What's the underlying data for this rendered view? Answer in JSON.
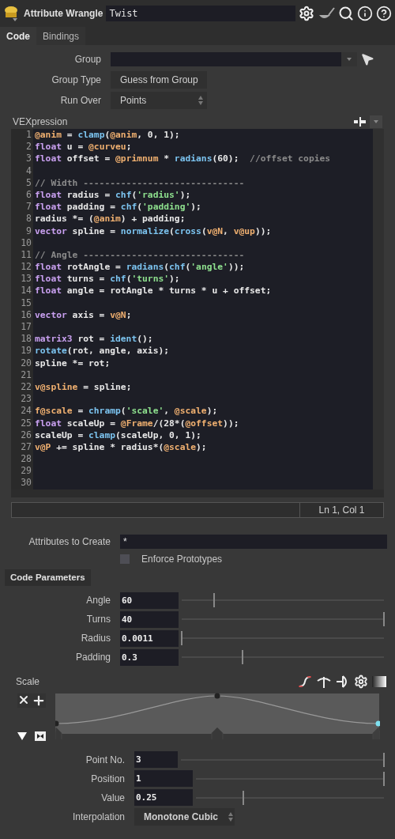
{
  "header": {
    "node_type": "Attribute Wrangle",
    "node_name": "Twist"
  },
  "tabs": [
    {
      "label": "Code",
      "selected": true
    },
    {
      "label": "Bindings",
      "selected": false
    }
  ],
  "fields": [
    {
      "kind": "text",
      "label": "Group"
    },
    {
      "kind": "menu",
      "label": "Group Type",
      "value": "Guess from Group"
    },
    {
      "kind": "menu",
      "label": "Run Over",
      "value": "Points"
    }
  ],
  "editor": {
    "label": "VEXpression",
    "lines": [
      {
        "n": "1",
        "tokens": [
          {
            "kind": "attr",
            "text": "@anim"
          },
          {
            "kind": "plain",
            "text": " = "
          },
          {
            "kind": "fn",
            "text": "clamp"
          },
          {
            "kind": "plain",
            "text": "("
          },
          {
            "kind": "attr",
            "text": "@anim"
          },
          {
            "kind": "plain",
            "text": ", 0, 1);"
          }
        ]
      },
      {
        "n": "2",
        "tokens": [
          {
            "kind": "kw",
            "text": "float"
          },
          {
            "kind": "plain",
            "text": " u = "
          },
          {
            "kind": "attr",
            "text": "@curveu"
          },
          {
            "kind": "plain",
            "text": ";"
          }
        ]
      },
      {
        "n": "3",
        "tokens": [
          {
            "kind": "kw",
            "text": "float"
          },
          {
            "kind": "plain",
            "text": " offset = "
          },
          {
            "kind": "attr",
            "text": "@primnum"
          },
          {
            "kind": "plain",
            "text": " * "
          },
          {
            "kind": "fn",
            "text": "radians"
          },
          {
            "kind": "plain",
            "text": "(60);  "
          },
          {
            "kind": "cm",
            "text": "//offset copies"
          }
        ]
      },
      {
        "n": "4"
      },
      {
        "n": "5",
        "tokens": [
          {
            "kind": "cm",
            "text": "// Width ------------------------------"
          }
        ]
      },
      {
        "n": "6",
        "tokens": [
          {
            "kind": "kw",
            "text": "float"
          },
          {
            "kind": "plain",
            "text": " radius = "
          },
          {
            "kind": "fn",
            "text": "chf"
          },
          {
            "kind": "plain",
            "text": "("
          },
          {
            "kind": "str",
            "text": "'radius'"
          },
          {
            "kind": "plain",
            "text": ");"
          }
        ]
      },
      {
        "n": "7",
        "tokens": [
          {
            "kind": "kw",
            "text": "float"
          },
          {
            "kind": "plain",
            "text": " padding = "
          },
          {
            "kind": "fn",
            "text": "chf"
          },
          {
            "kind": "plain",
            "text": "("
          },
          {
            "kind": "str",
            "text": "'padding'"
          },
          {
            "kind": "plain",
            "text": ");"
          }
        ]
      },
      {
        "n": "8",
        "tokens": [
          {
            "kind": "plain",
            "text": "radius *= ("
          },
          {
            "kind": "attr",
            "text": "@anim"
          },
          {
            "kind": "plain",
            "text": ") + padding;"
          }
        ]
      },
      {
        "n": "9",
        "tokens": [
          {
            "kind": "kw",
            "text": "vector"
          },
          {
            "kind": "plain",
            "text": " spline = "
          },
          {
            "kind": "fn",
            "text": "normalize"
          },
          {
            "kind": "plain",
            "text": "("
          },
          {
            "kind": "fn",
            "text": "cross"
          },
          {
            "kind": "plain",
            "text": "("
          },
          {
            "kind": "attr",
            "text": "v@N"
          },
          {
            "kind": "plain",
            "text": ", "
          },
          {
            "kind": "attr",
            "text": "v@up"
          },
          {
            "kind": "plain",
            "text": "));"
          }
        ]
      },
      {
        "n": "10"
      },
      {
        "n": "11",
        "tokens": [
          {
            "kind": "cm",
            "text": "// Angle ------------------------------"
          }
        ]
      },
      {
        "n": "12",
        "tokens": [
          {
            "kind": "kw",
            "text": "float"
          },
          {
            "kind": "plain",
            "text": " rotAngle = "
          },
          {
            "kind": "fn",
            "text": "radians"
          },
          {
            "kind": "plain",
            "text": "("
          },
          {
            "kind": "fn",
            "text": "chf"
          },
          {
            "kind": "plain",
            "text": "("
          },
          {
            "kind": "str",
            "text": "'angle'"
          },
          {
            "kind": "plain",
            "text": "));"
          }
        ]
      },
      {
        "n": "13",
        "tokens": [
          {
            "kind": "kw",
            "text": "float"
          },
          {
            "kind": "plain",
            "text": " turns = "
          },
          {
            "kind": "fn",
            "text": "chf"
          },
          {
            "kind": "plain",
            "text": "("
          },
          {
            "kind": "str",
            "text": "'turns'"
          },
          {
            "kind": "plain",
            "text": ");"
          }
        ]
      },
      {
        "n": "14",
        "tokens": [
          {
            "kind": "kw",
            "text": "float"
          },
          {
            "kind": "plain",
            "text": " angle = rotAngle * turns * u + offset;"
          }
        ]
      },
      {
        "n": "15"
      },
      {
        "n": "16",
        "tokens": [
          {
            "kind": "kw",
            "text": "vector"
          },
          {
            "kind": "plain",
            "text": " axis = "
          },
          {
            "kind": "attr",
            "text": "v@N"
          },
          {
            "kind": "plain",
            "text": ";"
          }
        ]
      },
      {
        "n": "17"
      },
      {
        "n": "18",
        "tokens": [
          {
            "kind": "kw",
            "text": "matrix3"
          },
          {
            "kind": "plain",
            "text": " rot = "
          },
          {
            "kind": "fn",
            "text": "ident"
          },
          {
            "kind": "plain",
            "text": "();"
          }
        ]
      },
      {
        "n": "19",
        "tokens": [
          {
            "kind": "fn",
            "text": "rotate"
          },
          {
            "kind": "plain",
            "text": "(rot, angle, axis);"
          }
        ]
      },
      {
        "n": "20",
        "tokens": [
          {
            "kind": "plain",
            "text": "spline *= rot;"
          }
        ]
      },
      {
        "n": "21"
      },
      {
        "n": "22",
        "tokens": [
          {
            "kind": "attr",
            "text": "v@spline"
          },
          {
            "kind": "plain",
            "text": " = spline;"
          }
        ]
      },
      {
        "n": "23"
      },
      {
        "n": "24",
        "tokens": [
          {
            "kind": "attr",
            "text": "f@scale"
          },
          {
            "kind": "plain",
            "text": " = "
          },
          {
            "kind": "fn",
            "text": "chramp"
          },
          {
            "kind": "plain",
            "text": "("
          },
          {
            "kind": "str",
            "text": "'scale'"
          },
          {
            "kind": "plain",
            "text": ", "
          },
          {
            "kind": "attr",
            "text": "@scale"
          },
          {
            "kind": "plain",
            "text": ");"
          }
        ]
      },
      {
        "n": "25",
        "tokens": [
          {
            "kind": "kw",
            "text": "float"
          },
          {
            "kind": "plain",
            "text": " scaleUp = "
          },
          {
            "kind": "attr",
            "text": "@Frame"
          },
          {
            "kind": "plain",
            "text": "/(28*("
          },
          {
            "kind": "attr",
            "text": "@offset"
          },
          {
            "kind": "plain",
            "text": "));"
          }
        ]
      },
      {
        "n": "26",
        "tokens": [
          {
            "kind": "plain",
            "text": "scaleUp = "
          },
          {
            "kind": "fn",
            "text": "clamp"
          },
          {
            "kind": "plain",
            "text": "(scaleUp, 0, 1);"
          }
        ]
      },
      {
        "n": "27",
        "tokens": [
          {
            "kind": "attr",
            "text": "v@P"
          },
          {
            "kind": "plain",
            "text": " += spline * radius*("
          },
          {
            "kind": "attr",
            "text": "@scale"
          },
          {
            "kind": "plain",
            "text": ");"
          }
        ]
      },
      {
        "n": "28"
      },
      {
        "n": "29"
      },
      {
        "n": "30"
      }
    ],
    "cursor": "Ln 1, Col 1"
  },
  "attributes_to_create": {
    "label": "Attributes to Create",
    "value": "*"
  },
  "enforce_prototypes": {
    "label": "Enforce Prototypes",
    "checked": false
  },
  "section": "Code Parameters",
  "parameters": [
    {
      "label": "Angle",
      "value": "60",
      "level": 0.16
    },
    {
      "label": "Turns",
      "value": "40",
      "level": 1
    },
    {
      "label": "Radius",
      "value": "0.0011",
      "level": 0
    },
    {
      "label": "Padding",
      "value": "0.3",
      "level": 0.3
    }
  ],
  "ramp": {
    "label": "Scale",
    "keys": [
      {
        "selected": false
      },
      {
        "selected": false
      },
      {
        "selected": true
      }
    ],
    "point_params": [
      {
        "kind": "slider",
        "label": "Point No.",
        "value": "3",
        "level": 1
      },
      {
        "kind": "slider",
        "label": "Position",
        "value": "1",
        "level": 1
      },
      {
        "kind": "slider",
        "label": "Value",
        "value": "0.25",
        "level": 0.25
      },
      {
        "kind": "menu",
        "label": "Interpolation",
        "value": "Monotone Cubic"
      }
    ]
  }
}
